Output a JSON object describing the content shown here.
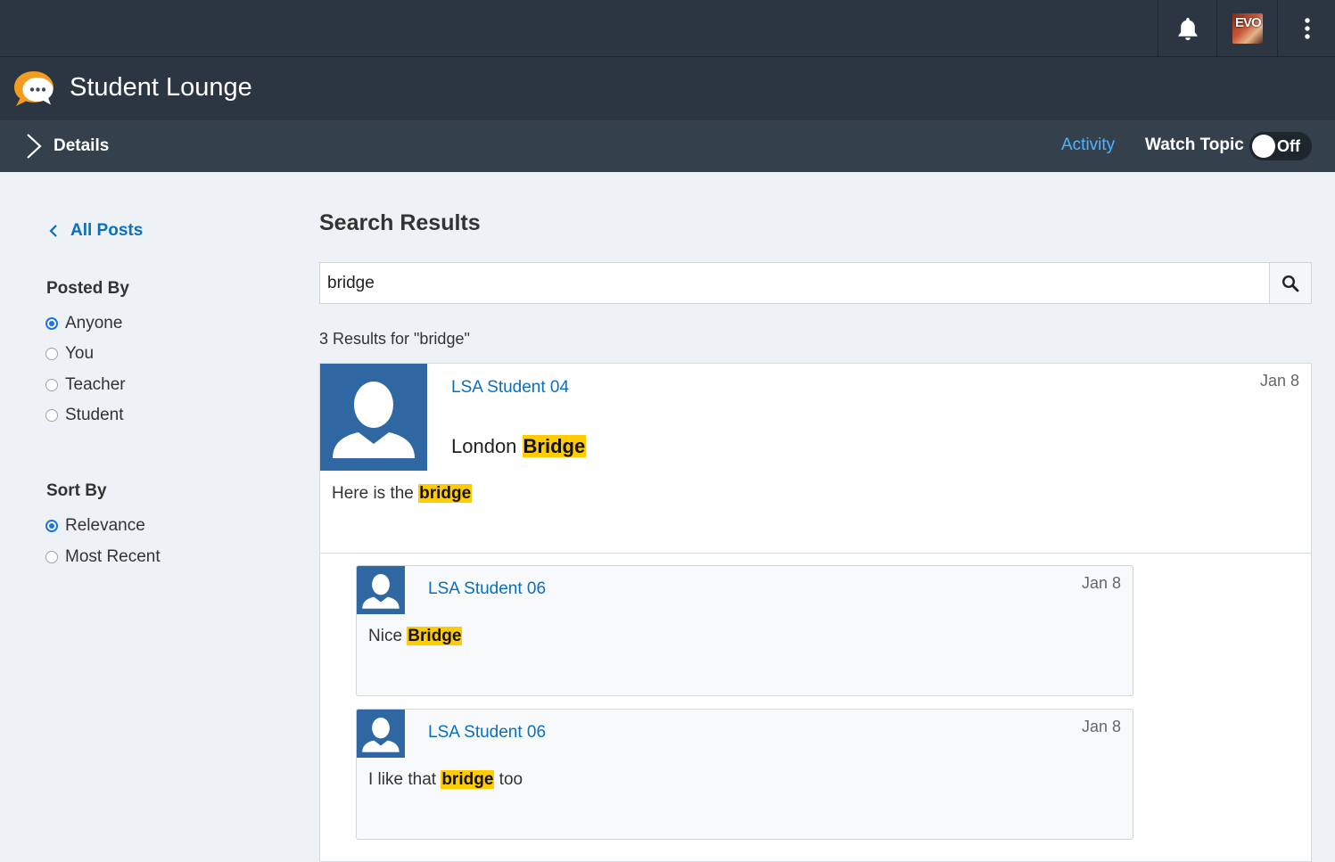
{
  "header": {
    "course_title": "Student Lounge",
    "notification_icon": "bell-icon",
    "menu_icon": "kebab-menu-icon",
    "avatar_text": "EVO"
  },
  "subheader": {
    "details_label": "Details",
    "activity_label": "Activity",
    "watch_topic_label": "Watch Topic",
    "watch_toggle_state": "Off"
  },
  "sidebar": {
    "back_label": "All Posts",
    "posted_by": {
      "title": "Posted By",
      "options": [
        "Anyone",
        "You",
        "Teacher",
        "Student"
      ],
      "selected": "Anyone"
    },
    "sort_by": {
      "title": "Sort By",
      "options": [
        "Relevance",
        "Most Recent"
      ],
      "selected": "Relevance"
    }
  },
  "search": {
    "title": "Search Results",
    "query": "bridge",
    "results_count": "3 Results for \"bridge\""
  },
  "posts": [
    {
      "author": "LSA Student 04",
      "date": "Jan 8",
      "title_prefix": "London",
      "title_highlight": "Bridge",
      "body_prefix": "Here is the",
      "body_highlight": "bridge",
      "body_suffix": ""
    },
    {
      "author": "LSA Student 06",
      "date": "Jan 8",
      "body_prefix": "Nice",
      "body_highlight": "Bridge",
      "body_suffix": ""
    },
    {
      "author": "LSA Student 06",
      "date": "Jan 8",
      "body_prefix": "I like that",
      "body_highlight": "bridge",
      "body_suffix": "too"
    }
  ],
  "colors": {
    "header_bg": "#2c3642",
    "link": "#0a6fbd",
    "highlight": "#ffcc00",
    "avatar_bg": "#2f67a3"
  }
}
